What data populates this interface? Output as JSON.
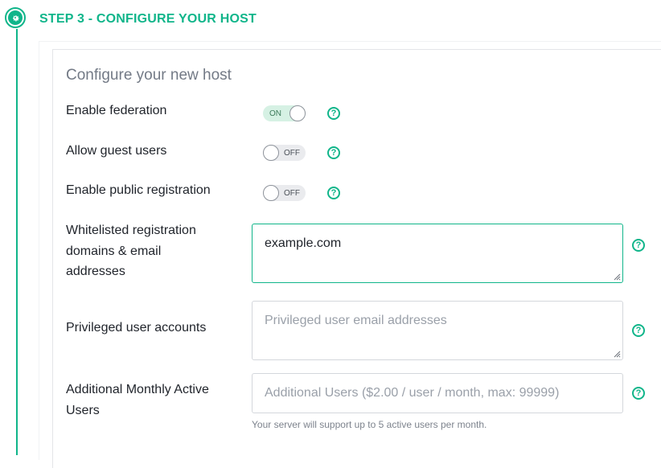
{
  "step": {
    "title": "STEP 3 - CONFIGURE YOUR HOST",
    "icon": "gear-icon",
    "accent_color": "#10b58a"
  },
  "section_title": "Configure your new host",
  "fields": {
    "federation": {
      "label": "Enable federation",
      "state": "ON"
    },
    "guest": {
      "label": "Allow guest users",
      "state": "OFF"
    },
    "public_reg": {
      "label": "Enable public registration",
      "state": "OFF"
    },
    "whitelist": {
      "label_lines": [
        "Whitelisted registration",
        "domains & email",
        "addresses"
      ],
      "value": "example.com"
    },
    "privileged": {
      "label": "Privileged user accounts",
      "placeholder": "Privileged user email addresses"
    },
    "mau": {
      "label_lines": [
        "Additional Monthly Active",
        "Users"
      ],
      "placeholder": "Additional Users ($2.00 / user / month, max: 99999)",
      "hint": "Your server will support up to 5 active users per month."
    }
  },
  "help_symbol": "?"
}
